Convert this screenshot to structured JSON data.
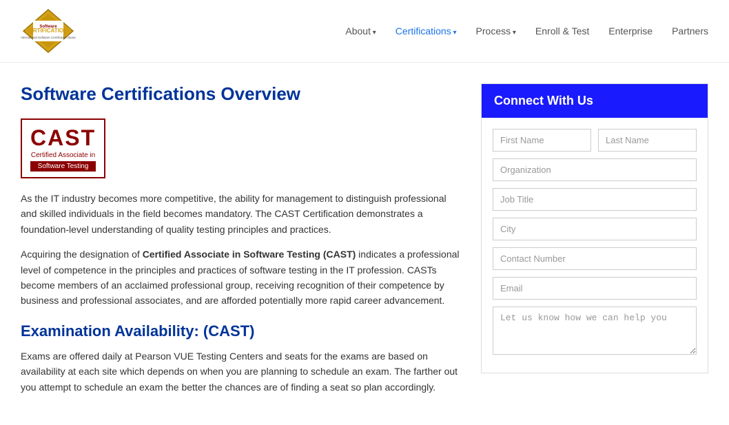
{
  "header": {
    "logo_alt": "Software Certifications",
    "nav_items": [
      {
        "label": "About",
        "active": false,
        "has_chevron": true
      },
      {
        "label": "Certifications",
        "active": true,
        "has_chevron": true
      },
      {
        "label": "Process",
        "active": false,
        "has_chevron": true
      },
      {
        "label": "Enroll & Test",
        "active": false,
        "has_chevron": false
      },
      {
        "label": "Enterprise",
        "active": false,
        "has_chevron": false
      },
      {
        "label": "Partners",
        "active": false,
        "has_chevron": false
      }
    ]
  },
  "main": {
    "page_title": "Software Certifications Overview",
    "cast_logo": {
      "acronym": "CAST",
      "line1": "Certified Associate in",
      "line2": "Software Testing"
    },
    "paragraph1": "As the IT industry becomes more competitive, the ability for management to distinguish professional and skilled individuals in the field becomes mandatory. The CAST Certification demonstrates a foundation-level understanding of quality testing principles and practices.",
    "paragraph2_prefix": "Acquiring the designation of ",
    "paragraph2_bold": "Certified Associate in Software Testing (CAST)",
    "paragraph2_suffix": " indicates a professional level of competence in the principles and practices of software testing in the IT profession. CASTs become members of an acclaimed professional group, receiving recognition of their competence by business and professional associates, and are afforded potentially more rapid career advancement.",
    "exam_title": "Examination Availability: (CAST)",
    "exam_text": "Exams are offered daily at Pearson VUE Testing Centers and seats for the exams are based on availability at each site which depends on when you are planning to schedule an exam. The farther out you attempt to schedule an exam the better the chances are of finding a seat so plan accordingly."
  },
  "sidebar": {
    "connect_header": "Connect With Us",
    "form": {
      "first_name_placeholder": "First Name",
      "last_name_placeholder": "Last Name",
      "organization_placeholder": "Organization",
      "job_title_placeholder": "Job Title",
      "city_placeholder": "City",
      "contact_number_placeholder": "Contact Number",
      "email_placeholder": "Email",
      "message_placeholder": "Let us know how we can help you"
    }
  }
}
